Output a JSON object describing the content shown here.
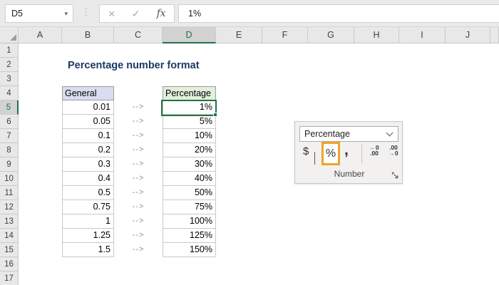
{
  "app": {
    "name_box": "D5",
    "formula": "1%",
    "fx_label": "fx",
    "cancel_icon": "×",
    "enter_icon": "✓",
    "dots_icon": "⋮",
    "name_box_chevron": "▾"
  },
  "grid": {
    "column_labels": [
      "",
      "A",
      "B",
      "C",
      "D",
      "E",
      "F",
      "G",
      "H",
      "I",
      "J",
      ""
    ],
    "row_numbers": [
      1,
      2,
      3,
      4,
      5,
      6,
      7,
      8,
      9,
      10,
      11,
      12,
      13,
      14,
      15,
      16,
      17
    ],
    "active_column": "D",
    "active_row": 5
  },
  "sheet": {
    "title": "Percentage number format"
  },
  "table": {
    "left_header": "General",
    "right_header": "Percentage",
    "arrow": "-->",
    "rows": [
      [
        "0.01",
        "1%"
      ],
      [
        "0.05",
        "5%"
      ],
      [
        "0.1",
        "10%"
      ],
      [
        "0.2",
        "20%"
      ],
      [
        "0.3",
        "30%"
      ],
      [
        "0.4",
        "40%"
      ],
      [
        "0.5",
        "50%"
      ],
      [
        "0.75",
        "75%"
      ],
      [
        "1",
        "100%"
      ],
      [
        "1.25",
        "125%"
      ],
      [
        "1.5",
        "150%"
      ]
    ]
  },
  "panel": {
    "dropdown_value": "Percentage",
    "currency_label": "$",
    "percent_label": "%",
    "comma_label": ",",
    "increase_decimal": {
      "top_arrow": "←",
      "top_text": "0",
      "bottom_text": ".00"
    },
    "decrease_decimal": {
      "top_text": ".00",
      "bottom_arrow": "→",
      "bottom_text": "0"
    },
    "group_label": "Number"
  },
  "colors": {
    "accent_green": "#217346",
    "highlight_orange": "#F0A32B",
    "left_header_fill": "#DADCF2",
    "right_header_fill": "#E2EFDA",
    "title_navy": "#1F3864",
    "decimal_arrow_blue": "#2F6FBF"
  }
}
